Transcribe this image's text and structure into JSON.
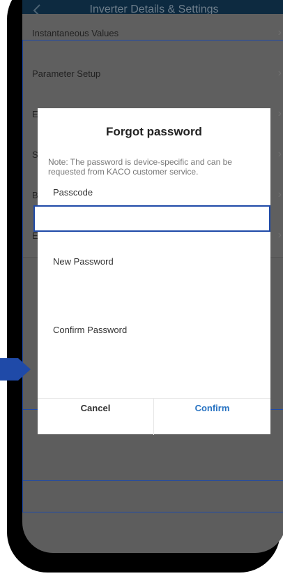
{
  "status_bar": {
    "left": "··",
    "right": "⌁ ◆ ▾"
  },
  "header": {
    "title": "Inverter Details & Settings"
  },
  "list": {
    "items": [
      {
        "label": "Instantaneous Values"
      },
      {
        "label": "Parameter Setup"
      },
      {
        "label": "E"
      },
      {
        "label": "S"
      },
      {
        "label": "B"
      },
      {
        "label": "E"
      }
    ]
  },
  "dialog": {
    "title": "Forgot password",
    "note": "Note: The password is device-specific and can be requested from KACO customer service.",
    "passcode_label": "Passcode",
    "passcode_value": "",
    "new_password_label": "New Password",
    "confirm_password_label": "Confirm Password",
    "cancel_label": "Cancel",
    "confirm_label": "Confirm"
  },
  "colors": {
    "appbar": "#0d2a40",
    "highlight_border": "#1f4aa8",
    "confirm_text": "#2873c2",
    "pointer_arrow": "#1f4aa8"
  },
  "icons": {
    "back": "chevron-left-icon",
    "row_arrow": "chevron-right-icon",
    "pointer": "arrow-pointer-icon"
  }
}
